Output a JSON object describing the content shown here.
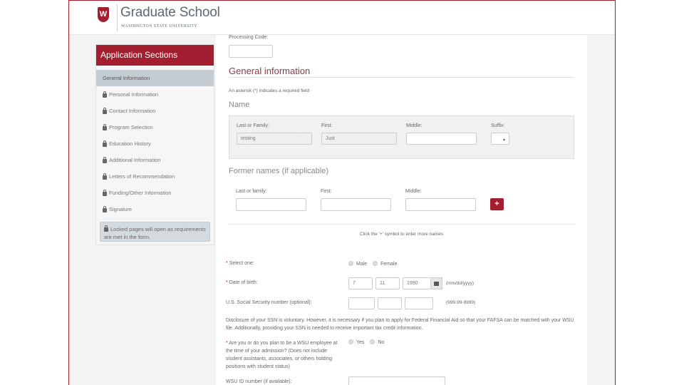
{
  "header": {
    "title": "Graduate School",
    "subtitle": "Washington State University",
    "logo_glyph": "W"
  },
  "sidebar": {
    "title": "Application Sections",
    "items": [
      {
        "label": "General Information",
        "locked": false,
        "active": true
      },
      {
        "label": "Personal Information",
        "locked": true
      },
      {
        "label": "Contact Information",
        "locked": true
      },
      {
        "label": "Program Selection",
        "locked": true
      },
      {
        "label": "Education History",
        "locked": true
      },
      {
        "label": "Additional Information",
        "locked": true
      },
      {
        "label": "Letters of Recommendation",
        "locked": true
      },
      {
        "label": "Funding/Other Information",
        "locked": true
      },
      {
        "label": "Signature",
        "locked": true
      }
    ],
    "note": "Locked pages will open as requirements are met in the form."
  },
  "form": {
    "processing_code_label": "Processing Code:",
    "processing_code_value": "",
    "section_title": "General information",
    "required_note": "An asterisk (*) indicates a required field",
    "name": {
      "heading": "Name",
      "last_label": "Last or Family:",
      "last_value": "testing",
      "first_label": "First:",
      "first_value": "Just",
      "middle_label": "Middle:",
      "middle_value": "",
      "suffix_label": "Suffix:",
      "suffix_value": ""
    },
    "former": {
      "heading": "Former names (if applicable)",
      "last_label": "Last or family:",
      "first_label": "First:",
      "middle_label": "Middle:",
      "plus_label": "+",
      "hint": "Click the '+' symbol to enter more names"
    },
    "gender": {
      "required_mark": "*",
      "label": "Select one:",
      "options": [
        "Male",
        "Female"
      ]
    },
    "dob": {
      "required_mark": "*",
      "label": "Date of birth:",
      "month": "7",
      "day": "11",
      "year": "1990",
      "format_hint": "(mm/dd/yyyy)"
    },
    "ssn": {
      "label": "U.S. Social Security number (optional):",
      "format_hint": "(999-99-9999)",
      "disclosure": "Disclosure of your SSN is voluntary. However, it is necessary if you plan to apply for Federal Financial Aid so that your FAFSA can be matched with your WSU file. Additionally, providing your SSN is needed to receive important tax credit information."
    },
    "employee": {
      "required_mark": "*",
      "label": "Are you or do you plan to be a WSU employee at the time of your admission? (Does not include student assistants, associates, or others holding positions with student status)",
      "options": [
        "Yes",
        "No"
      ]
    },
    "wsu_id": {
      "label": "WSU ID number (if available):",
      "value": ""
    }
  },
  "colors": {
    "brand": "#a31f2f",
    "active_nav": "#c3ccd3"
  }
}
